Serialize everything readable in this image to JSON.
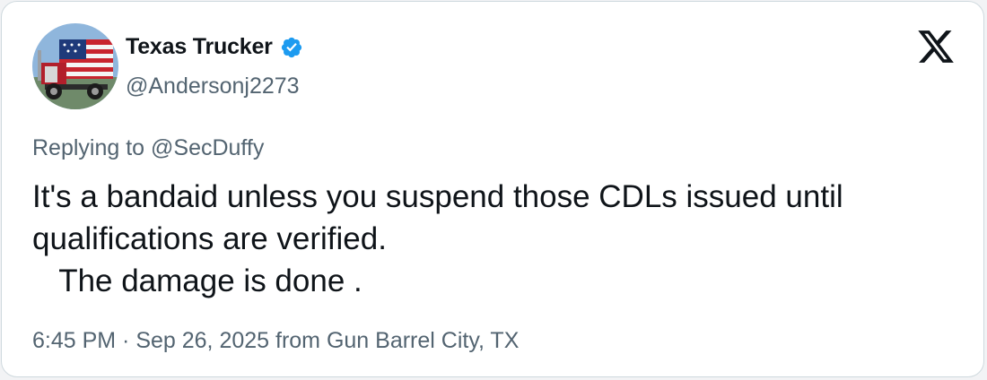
{
  "author": {
    "display_name": "Texas Trucker",
    "handle": "@Andersonj2273",
    "verified": true
  },
  "tweet": {
    "reply_context": "Replying to @SecDuffy",
    "text": "It's a bandaid unless you suspend those CDLs issued until\nqualifications are verified.\n   The damage is done .",
    "timestamp": "6:45 PM · Sep 26, 2025 from Gun Barrel City, TX"
  },
  "colors": {
    "verified_badge": "#1d9bf0",
    "secondary_text": "#536471",
    "primary_text": "#0f1419"
  },
  "icons": {
    "platform": "x-logo-icon",
    "verified": "verified-badge-icon"
  }
}
